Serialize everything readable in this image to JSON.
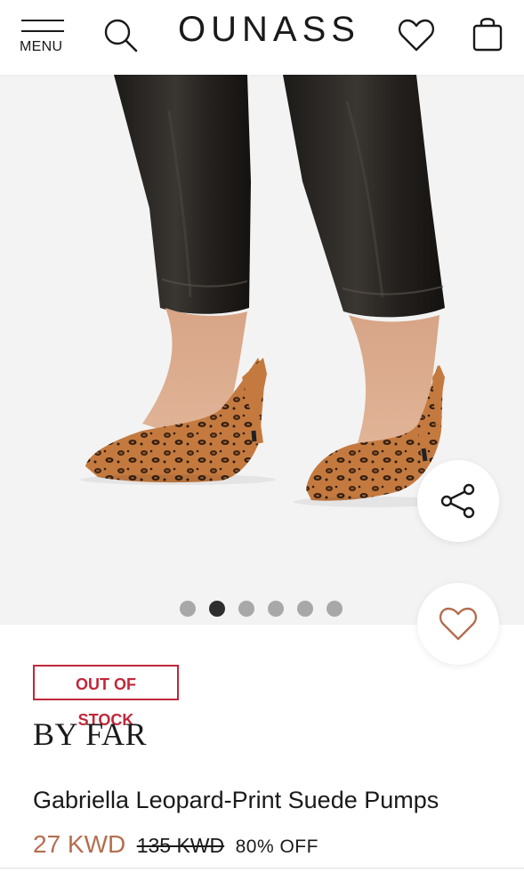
{
  "header": {
    "menu_label": "MENU",
    "logo_text": "OUNASS",
    "icons": [
      "menu-icon",
      "search-icon",
      "heart-icon",
      "bag-icon"
    ]
  },
  "gallery": {
    "image_description": "leopard-print suede slingback pumps",
    "dots": [
      {
        "active": false
      },
      {
        "active": true
      },
      {
        "active": false
      },
      {
        "active": false
      },
      {
        "active": false
      },
      {
        "active": false
      }
    ],
    "share_icon": "share-icon",
    "favorite_icon": "heart-outline-icon"
  },
  "product": {
    "stock_badge": "OUT OF STOCK",
    "brand": "BY FAR",
    "name": "Gabriella Leopard-Print Suede Pumps",
    "price_now": "27 KWD",
    "price_was": "135 KWD",
    "discount": "80% OFF"
  },
  "colors": {
    "badge_red": "#c0283a",
    "price_accent": "#b46e50",
    "dot_active": "#2d2d2d",
    "dot_inactive": "#a8a8a8"
  }
}
